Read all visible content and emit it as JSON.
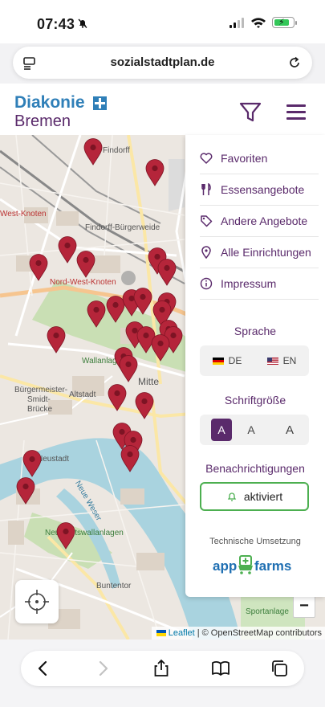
{
  "status_bar": {
    "time": "07:43"
  },
  "browser": {
    "url": "sozialstadtplan.de"
  },
  "header": {
    "logo_line1": "Diakonie",
    "logo_line2": "Bremen"
  },
  "map": {
    "labels": [
      {
        "text": "Findorff",
        "style": "normal"
      },
      {
        "text": "Findorff-Bürgerweide",
        "style": "normal"
      },
      {
        "text": "West-Knoten",
        "style": "red"
      },
      {
        "text": "Nord-West-Knoten",
        "style": "red"
      },
      {
        "text": "Mitte",
        "style": "normal"
      },
      {
        "text": "Altstadt",
        "style": "normal"
      },
      {
        "text": "Bürgermeister-",
        "style": "normal"
      },
      {
        "text": "Smidt-",
        "style": "normal"
      },
      {
        "text": "Brücke",
        "style": "normal"
      },
      {
        "text": "Neustadt",
        "style": "normal"
      },
      {
        "text": "Neue Weser",
        "style": "normal"
      },
      {
        "text": "Neustadtswallanlagen",
        "style": "normal"
      },
      {
        "text": "Buntentor",
        "style": "normal"
      },
      {
        "text": "Wallanlagen",
        "style": "normal"
      },
      {
        "text": "Sportanlage",
        "style": "normal"
      }
    ],
    "attribution_leaflet": "Leaflet",
    "attribution_rest": "| © OpenStreetMap contributors",
    "zoom_out_label": "−"
  },
  "menu": {
    "items": [
      {
        "label": "Favoriten",
        "icon": "heart-icon"
      },
      {
        "label": "Essensangebote",
        "icon": "cutlery-icon"
      },
      {
        "label": "Andere Angebote",
        "icon": "tag-icon"
      },
      {
        "label": "Alle Einrichtungen",
        "icon": "location-pin-icon"
      },
      {
        "label": "Impressum",
        "icon": "info-icon"
      }
    ],
    "language_title": "Sprache",
    "languages": [
      {
        "code": "DE"
      },
      {
        "code": "EN"
      }
    ],
    "font_size_title": "Schriftgröße",
    "font_sizes": [
      "A",
      "A",
      "A"
    ],
    "notifications_title": "Benachrichtigungen",
    "notifications_button": "aktiviert",
    "tech_title": "Technische Umsetzung",
    "tech_logo": "appfarms"
  },
  "colors": {
    "brand_purple": "#5a2a6b",
    "brand_blue": "#2f7fb8",
    "pin_red": "#b5253a",
    "success_green": "#4caf50"
  }
}
